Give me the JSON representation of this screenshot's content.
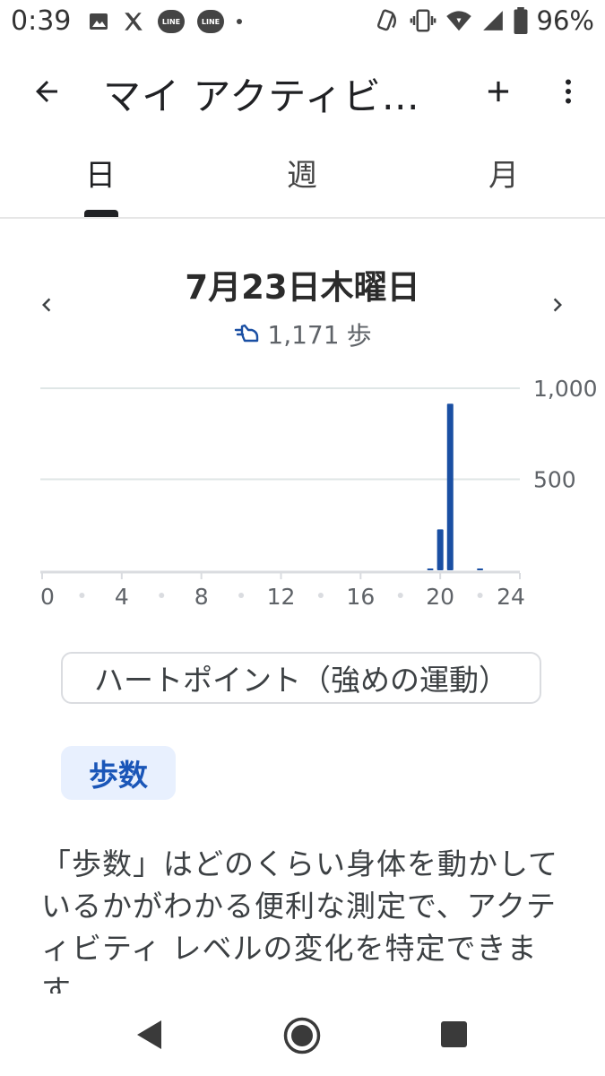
{
  "status_bar": {
    "time": "0:39",
    "battery_percent": "96%",
    "left_icons": [
      "image-icon",
      "x-icon",
      "line-icon",
      "line-icon",
      "dot-icon"
    ],
    "right_icons": [
      "nfc-icon",
      "vibrate-icon",
      "wifi-icon",
      "signal-icon",
      "battery-icon"
    ]
  },
  "app_bar": {
    "title": "マイ アクティビ…",
    "back_icon": "arrow-back-icon",
    "add_icon": "plus-icon",
    "more_icon": "more-vert-icon"
  },
  "tabs": [
    {
      "label": "日",
      "active": true
    },
    {
      "label": "週",
      "active": false
    },
    {
      "label": "月",
      "active": false
    }
  ],
  "date_nav": {
    "date": "7月23日木曜日",
    "steps_value": "1,171",
    "steps_unit": "歩"
  },
  "chart_data": {
    "type": "bar",
    "x_ticks": [
      "0",
      "4",
      "8",
      "12",
      "16",
      "20",
      "24"
    ],
    "y_ticks": [
      "500",
      "1,000"
    ],
    "ylim": [
      0,
      1000
    ],
    "xlim": [
      0,
      24
    ],
    "bar_color": "#1a4fa3",
    "grid": true,
    "series": [
      {
        "x": [
          19.5,
          20,
          20.5,
          22
        ],
        "values": [
          8,
          225,
          915,
          5
        ]
      }
    ]
  },
  "chips": {
    "heart_points": "ハートポイント（強めの運動）",
    "steps": "歩数"
  },
  "description": "「歩数」はどのくらい身体を動かしているかがわかる便利な測定で、アクティビティ レベルの変化を特定できます",
  "nav_bar": {
    "icons": [
      "triangle-back-icon",
      "home-circle-icon",
      "recents-square-icon"
    ]
  }
}
